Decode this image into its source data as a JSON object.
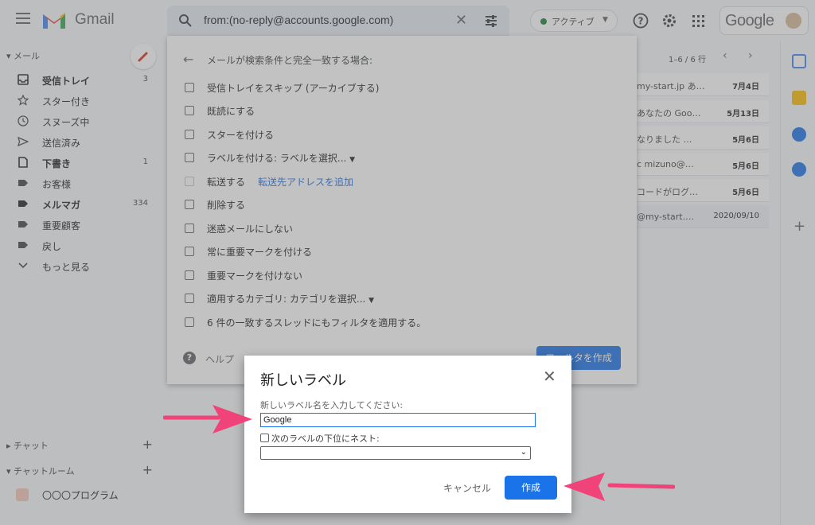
{
  "header": {
    "app_name": "Gmail",
    "search_query": "from:(no-reply@accounts.google.com)",
    "status_label": "アクティブ",
    "account_brand": "Google"
  },
  "sidebar": {
    "mail_section": "メール",
    "items": [
      {
        "label": "受信トレイ",
        "count": "3",
        "bold": true
      },
      {
        "label": "スター付き",
        "count": ""
      },
      {
        "label": "スヌーズ中",
        "count": ""
      },
      {
        "label": "送信済み",
        "count": ""
      },
      {
        "label": "下書き",
        "count": "1",
        "bold": true
      },
      {
        "label": "お客様",
        "count": ""
      },
      {
        "label": "メルマガ",
        "count": "334",
        "bold": true
      },
      {
        "label": "重要顧客",
        "count": ""
      },
      {
        "label": "戻し",
        "count": ""
      },
      {
        "label": "もっと見る",
        "count": ""
      }
    ],
    "chat_section": "チャット",
    "chatroom_section": "チャットルーム",
    "chatroom_item": "〇〇〇プログラム"
  },
  "mail_list": {
    "pager": "1–6 / 6 行",
    "rows": [
      {
        "snippet": "my-start.jp あ…",
        "date": "7月4日"
      },
      {
        "snippet": "あなたの Goo…",
        "date": "5月13日"
      },
      {
        "snippet": "なりました …",
        "date": "5月6日"
      },
      {
        "snippet": "c mizuno@…",
        "date": "5月6日"
      },
      {
        "snippet": "コードがログ…",
        "date": "5月6日"
      },
      {
        "snippet": "@my-start.…",
        "date": "2020/09/10"
      }
    ]
  },
  "filter_panel": {
    "title": "メールが検索条件と完全一致する場合:",
    "options": [
      {
        "label": "受信トレイをスキップ (アーカイブする)"
      },
      {
        "label": "既読にする"
      },
      {
        "label": "スターを付ける"
      },
      {
        "label": "ラベルを付ける:",
        "select": "ラベルを選択..."
      },
      {
        "label": "転送する",
        "link": "転送先アドレスを追加"
      },
      {
        "label": "削除する"
      },
      {
        "label": "迷惑メールにしない"
      },
      {
        "label": "常に重要マークを付ける"
      },
      {
        "label": "重要マークを付けない"
      },
      {
        "label": "適用するカテゴリ:",
        "select": "カテゴリを選択..."
      },
      {
        "label": "6 件の一致するスレッドにもフィルタを適用する。"
      }
    ],
    "help": "ヘルプ",
    "create_button": "フィルタを作成"
  },
  "dialog": {
    "title": "新しいラベル",
    "prompt": "新しいラベル名を入力してください:",
    "input_value": "Google",
    "nest_label": "次のラベルの下位にネスト:",
    "cancel": "キャンセル",
    "create": "作成"
  },
  "colors": {
    "accent": "#1a73e8",
    "arrow": "#f0437a",
    "active_dot": "#188038"
  }
}
